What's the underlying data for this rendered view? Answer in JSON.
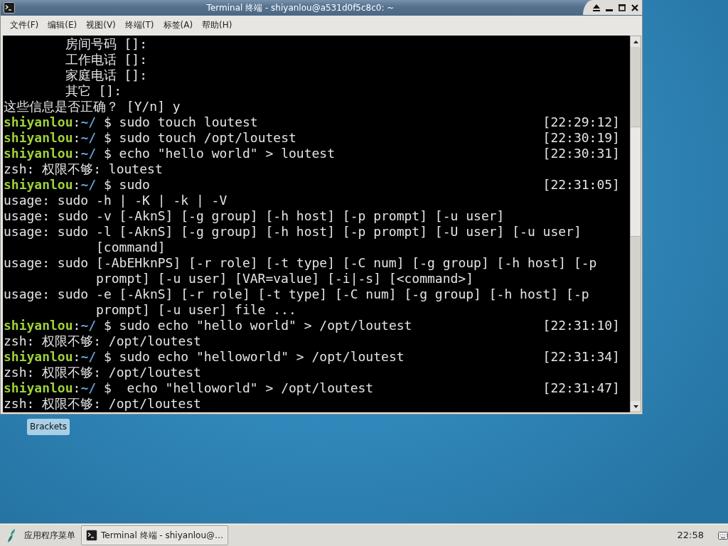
{
  "window": {
    "title": "Terminal 终端 - shiyanlou@a531d0f5c8c0: ~"
  },
  "menu": [
    "文件(F)",
    "编辑(E)",
    "视图(V)",
    "终端(T)",
    "标签(A)",
    "帮助(H)"
  ],
  "terminal": {
    "lines": [
      {
        "kind": "field",
        "text": "房间号码 []:"
      },
      {
        "kind": "field",
        "text": "工作电话 []:"
      },
      {
        "kind": "field",
        "text": "家庭电话 []:"
      },
      {
        "kind": "field",
        "text": "其它 []:"
      },
      {
        "kind": "output",
        "text": "这些信息是否正确？ [Y/n] y"
      },
      {
        "kind": "prompt",
        "user": "shiyanlou",
        "colon": ":",
        "path": "~/",
        "symbol": "$",
        "command": "sudo touch loutest",
        "time": "[22:29:12]"
      },
      {
        "kind": "prompt",
        "user": "shiyanlou",
        "colon": ":",
        "path": "~/",
        "symbol": "$",
        "command": "sudo touch /opt/loutest",
        "time": "[22:30:19]"
      },
      {
        "kind": "prompt",
        "user": "shiyanlou",
        "colon": ":",
        "path": "~/",
        "symbol": "$",
        "command": "echo \"hello world\" > loutest",
        "time": "[22:30:31]"
      },
      {
        "kind": "output",
        "text": "zsh: 权限不够: loutest"
      },
      {
        "kind": "prompt",
        "user": "shiyanlou",
        "colon": ":",
        "path": "~/",
        "symbol": "$",
        "command": "sudo",
        "time": "[22:31:05]"
      },
      {
        "kind": "output",
        "text": "usage: sudo -h | -K | -k | -V"
      },
      {
        "kind": "output",
        "text": "usage: sudo -v [-AknS] [-g group] [-h host] [-p prompt] [-u user]"
      },
      {
        "kind": "output",
        "text": "usage: sudo -l [-AknS] [-g group] [-h host] [-p prompt] [-U user] [-u user]"
      },
      {
        "kind": "wrapped",
        "text": "[command]"
      },
      {
        "kind": "output",
        "text": "usage: sudo [-AbEHknPS] [-r role] [-t type] [-C num] [-g group] [-h host] [-p"
      },
      {
        "kind": "wrapped",
        "text": "prompt] [-u user] [VAR=value] [-i|-s] [<command>]"
      },
      {
        "kind": "output",
        "text": "usage: sudo -e [-AknS] [-r role] [-t type] [-C num] [-g group] [-h host] [-p"
      },
      {
        "kind": "wrapped",
        "text": "prompt] [-u user] file ..."
      },
      {
        "kind": "prompt",
        "user": "shiyanlou",
        "colon": ":",
        "path": "~/",
        "symbol": "$",
        "command": "sudo echo \"hello world\" > /opt/loutest",
        "time": "[22:31:10]"
      },
      {
        "kind": "output",
        "text": "zsh: 权限不够: /opt/loutest"
      },
      {
        "kind": "prompt",
        "user": "shiyanlou",
        "colon": ":",
        "path": "~/",
        "symbol": "$",
        "command": "sudo echo \"helloworld\" > /opt/loutest",
        "time": "[22:31:34]"
      },
      {
        "kind": "output",
        "text": "zsh: 权限不够: /opt/loutest"
      },
      {
        "kind": "prompt",
        "user": "shiyanlou",
        "colon": ":",
        "path": "~/",
        "symbol": "$",
        "command": " echo \"helloworld\" > /opt/loutest",
        "time": "[22:31:47]"
      },
      {
        "kind": "output",
        "text": "zsh: 权限不够: /opt/loutest"
      }
    ]
  },
  "desktop": {
    "icons": [
      {
        "label": "Brackets"
      }
    ]
  },
  "taskbar": {
    "app_menu": "应用程序菜单",
    "windows": [
      {
        "label": "Terminal 终端 - shiyanlou@…",
        "selected": true
      }
    ],
    "clock": "22:58"
  }
}
